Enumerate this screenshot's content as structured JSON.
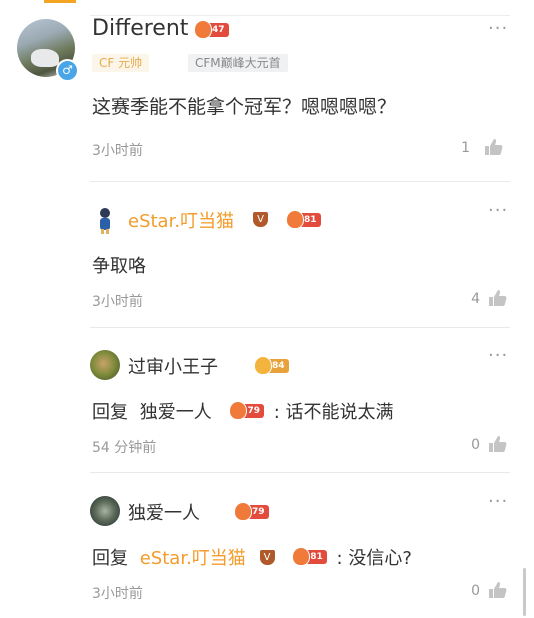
{
  "main_comment": {
    "username": "Different",
    "level": "47",
    "tags": [
      "CF 元帅",
      "CFM巅峰大元首"
    ],
    "text": "这赛季能不能拿个冠军？嗯嗯嗯嗯？",
    "time": "3小时前",
    "likes": "1",
    "gender_icon": "male-icon"
  },
  "replies": [
    {
      "username": "eStar.叮当猫",
      "vip": "V",
      "level": "81",
      "text": "争取咯",
      "time": "3小时前",
      "likes": "4"
    },
    {
      "username": "过审小王子",
      "level": "84",
      "reply_prefix": "回复",
      "reply_to": "独爱一人",
      "reply_to_level": "79",
      "text": ": 话不能说太满",
      "time": "54 分钟前",
      "likes": "0"
    },
    {
      "username": "独爱一人",
      "level": "79",
      "reply_prefix": "回复",
      "reply_to": "eStar.叮当猫",
      "reply_to_vip": "V",
      "reply_to_level": "81",
      "text": ": 没信心?",
      "time": "3小时前",
      "likes": "0"
    }
  ],
  "colors": {
    "accent_orange": "#f39c2b",
    "level_badge": "#e34b3c",
    "tag_gold_text": "#e7aa4b",
    "muted_text": "#999999"
  },
  "icons": {
    "more": "more-icon",
    "like": "thumbs-up-icon"
  },
  "more_glyph": "···"
}
